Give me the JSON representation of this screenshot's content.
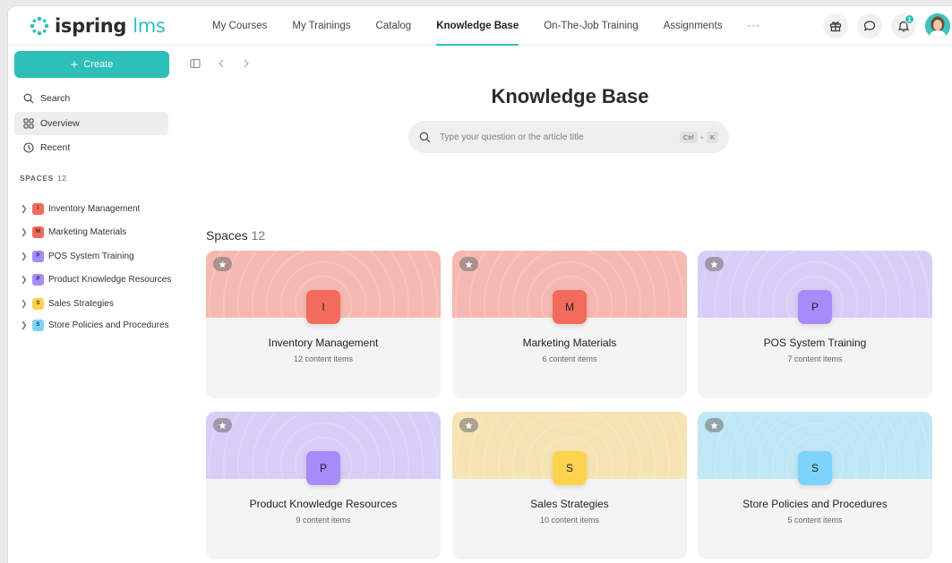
{
  "app": {
    "logo_main": "ispring",
    "logo_accent": "lms",
    "accent_color": "#2dbfb8"
  },
  "nav": {
    "items": [
      "My Courses",
      "My Trainings",
      "Catalog",
      "Knowledge Base",
      "On-The-Job Training",
      "Assignments"
    ],
    "active": "Knowledge Base",
    "more": "···",
    "notification_count": "1"
  },
  "sidebar": {
    "create_label": "Create",
    "items": [
      {
        "label": "Search",
        "icon": "search-icon"
      },
      {
        "label": "Overview",
        "icon": "grid-icon"
      },
      {
        "label": "Recent",
        "icon": "clock-icon"
      }
    ],
    "spaces_heading": "SPACES",
    "spaces_count": "12",
    "tree": [
      {
        "letter": "I",
        "label": "Inventory Management",
        "color": "#f26b5b"
      },
      {
        "letter": "M",
        "label": "Marketing Materials",
        "color": "#f26b5b"
      },
      {
        "letter": "P",
        "label": "POS System Training",
        "color": "#a78bfa"
      },
      {
        "letter": "P",
        "label": "Product Knowledge Resources",
        "color": "#a78bfa"
      },
      {
        "letter": "S",
        "label": "Sales Strategies",
        "color": "#fcd34d"
      },
      {
        "letter": "S",
        "label": "Store Policies and Procedures",
        "color": "#7dd3fc"
      }
    ]
  },
  "main": {
    "title": "Knowledge Base",
    "search_placeholder": "Type your question or the article title",
    "shortcut_ctrl": "Ctrl",
    "shortcut_plus": "+",
    "shortcut_key": "K",
    "spaces_label": "Spaces",
    "spaces_count": "12"
  },
  "cards": [
    {
      "letter": "I",
      "name": "Inventory Management",
      "count": "12 content items",
      "tile": "#f26b5b",
      "top": "#f6b9b1"
    },
    {
      "letter": "M",
      "name": "Marketing Materials",
      "count": "6 content items",
      "tile": "#f26b5b",
      "top": "#f6b9b1"
    },
    {
      "letter": "P",
      "name": "POS System Training",
      "count": "7 content items",
      "tile": "#a78bfa",
      "top": "#d8cdf7"
    },
    {
      "letter": "P",
      "name": "Product Knowledge Resources",
      "count": "9 content items",
      "tile": "#a78bfa",
      "top": "#d8cdf7"
    },
    {
      "letter": "S",
      "name": "Sales Strategies",
      "count": "10 content items",
      "tile": "#fcd34d",
      "top": "#f6e4b4"
    },
    {
      "letter": "S",
      "name": "Store Policies and Procedures",
      "count": "5 content items",
      "tile": "#7dd3fc",
      "top": "#bfe7f6"
    }
  ]
}
